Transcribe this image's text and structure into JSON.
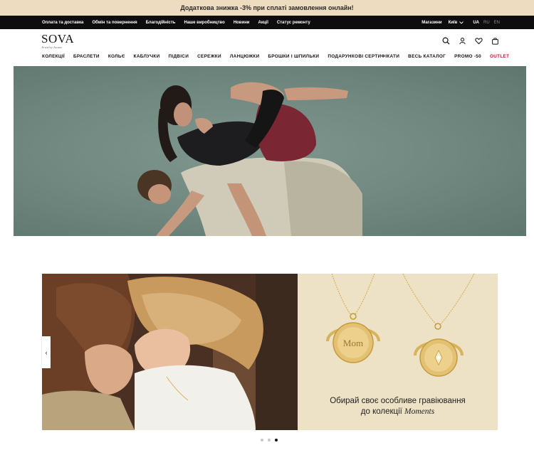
{
  "promo_bar": {
    "text": "Додаткова знижка -3% при сплаті замовлення онлайн!"
  },
  "service_bar": {
    "links": [
      "Оплата та доставка",
      "Обмін та повернення",
      "Благодійність",
      "Наше виробництво",
      "Новини",
      "Акції",
      "Статус ремонту"
    ],
    "stores": "Магазини",
    "city": "Київ",
    "languages": [
      {
        "code": "UA",
        "active": true
      },
      {
        "code": "RU",
        "active": false
      },
      {
        "code": "EN",
        "active": false
      }
    ]
  },
  "header": {
    "logo": "SOVA",
    "logo_sub": "Jewelry house",
    "icons": [
      "search-icon",
      "account-icon",
      "wishlist-icon",
      "cart-icon"
    ]
  },
  "nav": {
    "items": [
      "КОЛЕКЦІЇ",
      "БРАСЛЕТИ",
      "КОЛЬЄ",
      "КАБЛУЧКИ",
      "ПІДВІСИ",
      "СЕРЕЖКИ",
      "ЛАНЦЮЖКИ",
      "БРОШКИ І ШПИЛЬКИ",
      "ПОДАРУНКОВІ СЕРТИФІКАТИ",
      "ВЕСЬ КАТАЛОГ",
      "PROMO -50"
    ],
    "outlet": "OUTLET",
    "outlet_color": "#c8102e"
  },
  "slider": {
    "caption_line1": "Обирай своє особливе гравіювання",
    "caption_line2_prefix": "до колекції ",
    "caption_line2_italic": "Moments",
    "pendant_engraving": "Mom",
    "active_dot": 3,
    "dot_count": 3
  },
  "colors": {
    "promo_bg": "#eddcbf",
    "service_bg": "#0d0d0d",
    "hero_bg": "#6f877f",
    "promo_slide_bg": "#eee2c6",
    "gold": "#d7b35a"
  }
}
